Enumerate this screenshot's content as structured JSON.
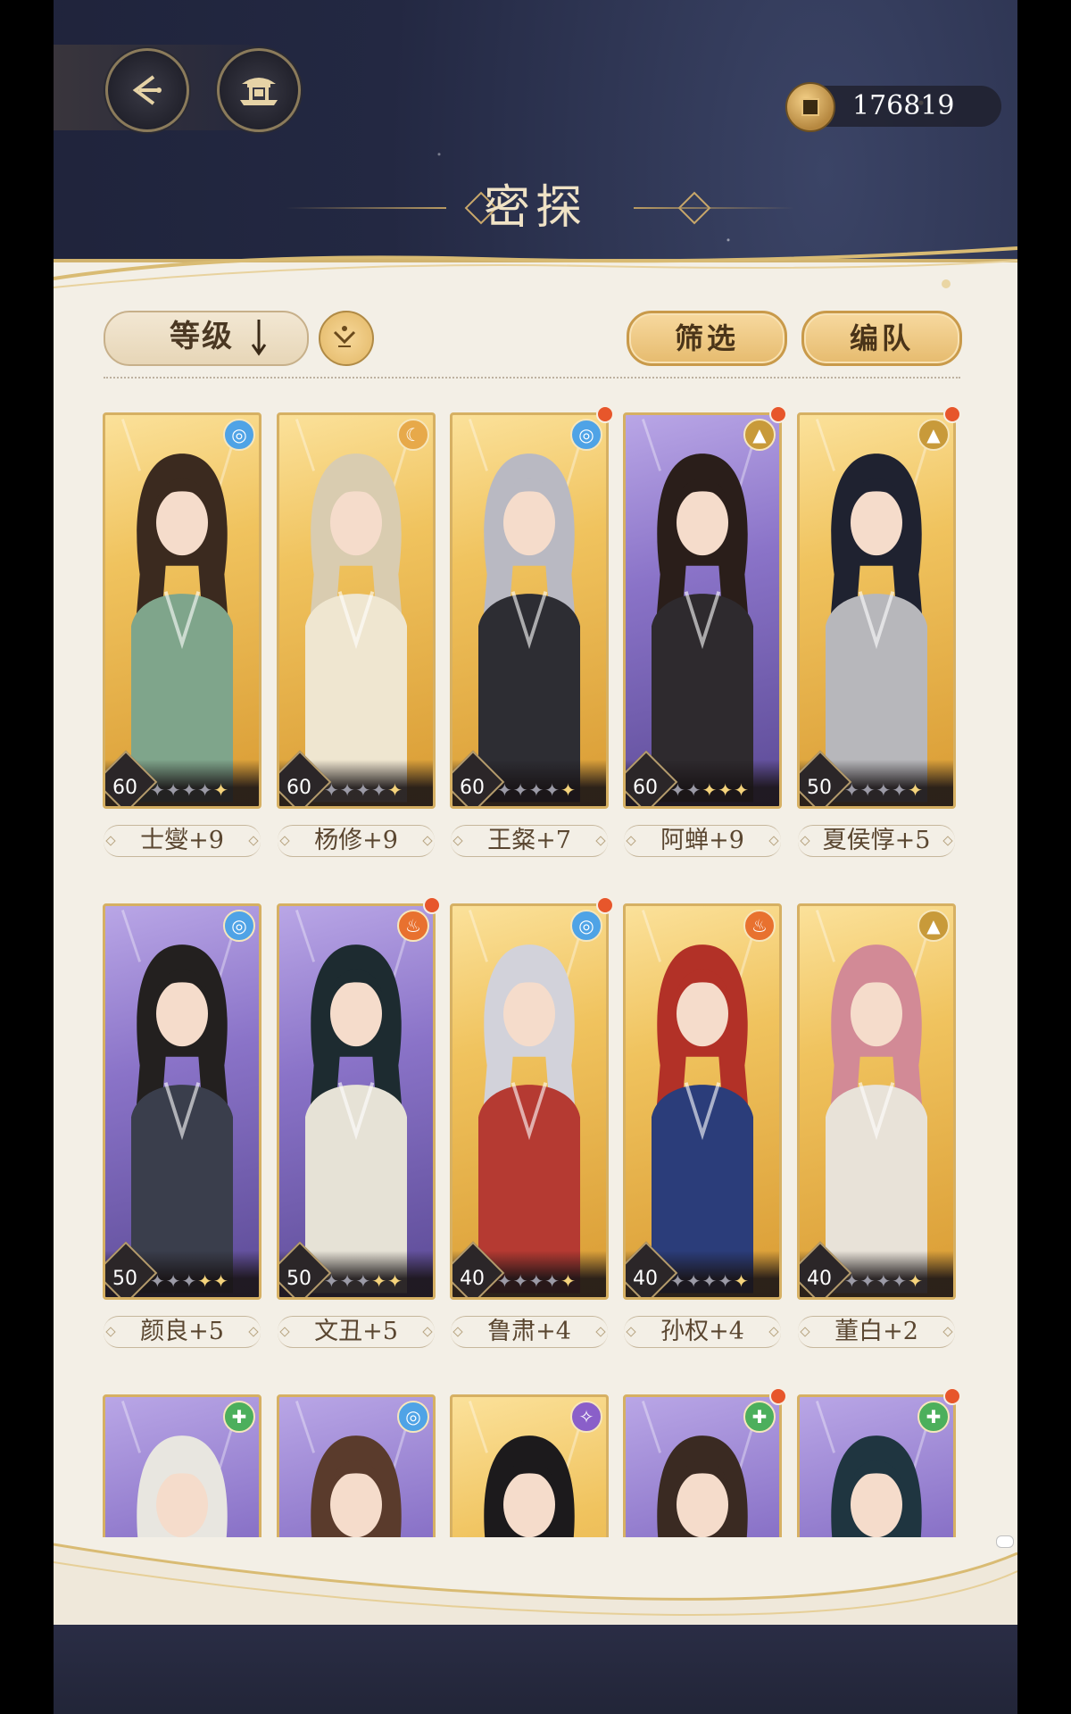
{
  "header": {
    "title": "密探",
    "currency_value": "176819",
    "plus_label": "+"
  },
  "icons": {
    "back": "back-arrow-icon",
    "home": "pavilion-icon",
    "coin": "copper-coin-icon"
  },
  "toolbar": {
    "sort_label": "等级",
    "sort_direction": "descending",
    "filter_label": "筛选",
    "team_label": "编队"
  },
  "colors": {
    "element_water": "#4fa3e6",
    "element_moon": "#e7a94a",
    "element_earth": "#c89a3a",
    "element_fire": "#e8712f",
    "element_wood": "#4caf5c",
    "element_star": "#8a5fc9",
    "notify_dot": "#e7562b"
  },
  "characters": [
    {
      "name": "士燮+9",
      "level": "60",
      "stars": 5,
      "stars_lit": 1,
      "element": "water",
      "frame": "gold",
      "new": false
    },
    {
      "name": "杨修+9",
      "level": "60",
      "stars": 5,
      "stars_lit": 1,
      "element": "moon",
      "frame": "gold",
      "new": false
    },
    {
      "name": "王粲+7",
      "level": "60",
      "stars": 5,
      "stars_lit": 1,
      "element": "water",
      "frame": "gold",
      "new": true
    },
    {
      "name": "阿蝉+9",
      "level": "60",
      "stars": 5,
      "stars_lit": 3,
      "element": "earth",
      "frame": "purple",
      "new": true
    },
    {
      "name": "夏侯惇+5",
      "level": "50",
      "stars": 5,
      "stars_lit": 1,
      "element": "earth",
      "frame": "gold",
      "new": true
    },
    {
      "name": "颜良+5",
      "level": "50",
      "stars": 5,
      "stars_lit": 2,
      "element": "water",
      "frame": "purple",
      "new": false
    },
    {
      "name": "文丑+5",
      "level": "50",
      "stars": 5,
      "stars_lit": 2,
      "element": "fire",
      "frame": "purple",
      "new": true
    },
    {
      "name": "鲁肃+4",
      "level": "40",
      "stars": 5,
      "stars_lit": 1,
      "element": "water",
      "frame": "gold",
      "new": true
    },
    {
      "name": "孙权+4",
      "level": "40",
      "stars": 5,
      "stars_lit": 1,
      "element": "fire",
      "frame": "gold",
      "new": false
    },
    {
      "name": "董白+2",
      "level": "40",
      "stars": 5,
      "stars_lit": 1,
      "element": "earth",
      "frame": "gold",
      "new": false
    },
    {
      "name": "",
      "level": "",
      "stars": 0,
      "stars_lit": 0,
      "element": "wood",
      "frame": "purple",
      "new": false
    },
    {
      "name": "",
      "level": "",
      "stars": 0,
      "stars_lit": 0,
      "element": "water",
      "frame": "purple",
      "new": false
    },
    {
      "name": "",
      "level": "",
      "stars": 0,
      "stars_lit": 0,
      "element": "star",
      "frame": "gold",
      "new": false
    },
    {
      "name": "",
      "level": "",
      "stars": 0,
      "stars_lit": 0,
      "element": "wood",
      "frame": "purple",
      "new": true
    },
    {
      "name": "",
      "level": "",
      "stars": 0,
      "stars_lit": 0,
      "element": "wood",
      "frame": "purple",
      "new": true
    }
  ]
}
